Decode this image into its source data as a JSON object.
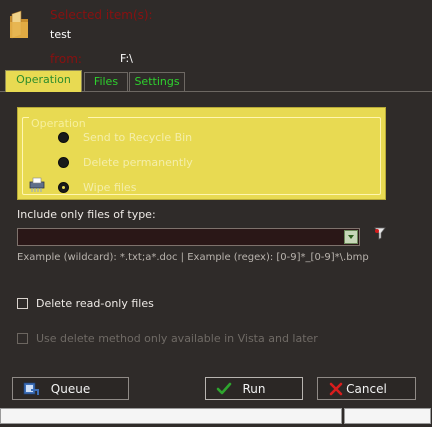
{
  "header": {
    "selected_items_label": "Selected item(s):",
    "selected_items_value": "test",
    "from_label": "from:",
    "from_value": "F:\\"
  },
  "tabs": [
    {
      "label": "Operation",
      "active": true
    },
    {
      "label": "Files",
      "active": false
    },
    {
      "label": "Settings",
      "active": false
    }
  ],
  "operation": {
    "group_title": "Operation",
    "options": [
      {
        "label": "Send to Recycle Bin",
        "selected": false
      },
      {
        "label": "Delete permanently",
        "selected": false
      },
      {
        "label": "Wipe files",
        "selected": true
      }
    ]
  },
  "include": {
    "label": "Include only files of type:",
    "value": "",
    "example": "Example (wildcard): *.txt;a*.doc  |  Example (regex): [0-9]*_[0-9]*\\.bmp"
  },
  "options": {
    "delete_readonly_label": "Delete read-only files",
    "delete_readonly_checked": false,
    "vista_method_label": "Use delete method only available in Vista and later",
    "vista_method_checked": false,
    "vista_method_enabled": false
  },
  "buttons": {
    "queue": "Queue",
    "run": "Run",
    "cancel": "Cancel"
  },
  "colors": {
    "accent_yellow": "#e8da52",
    "tab_text_green": "#2ed12e",
    "header_label_red": "#8a1010",
    "background": "#2f2b29"
  },
  "icons": [
    "folder-icon",
    "shredder-icon",
    "filter-icon",
    "queue-icon",
    "check-icon",
    "cancel-x-icon",
    "dropdown-arrow-icon"
  ]
}
